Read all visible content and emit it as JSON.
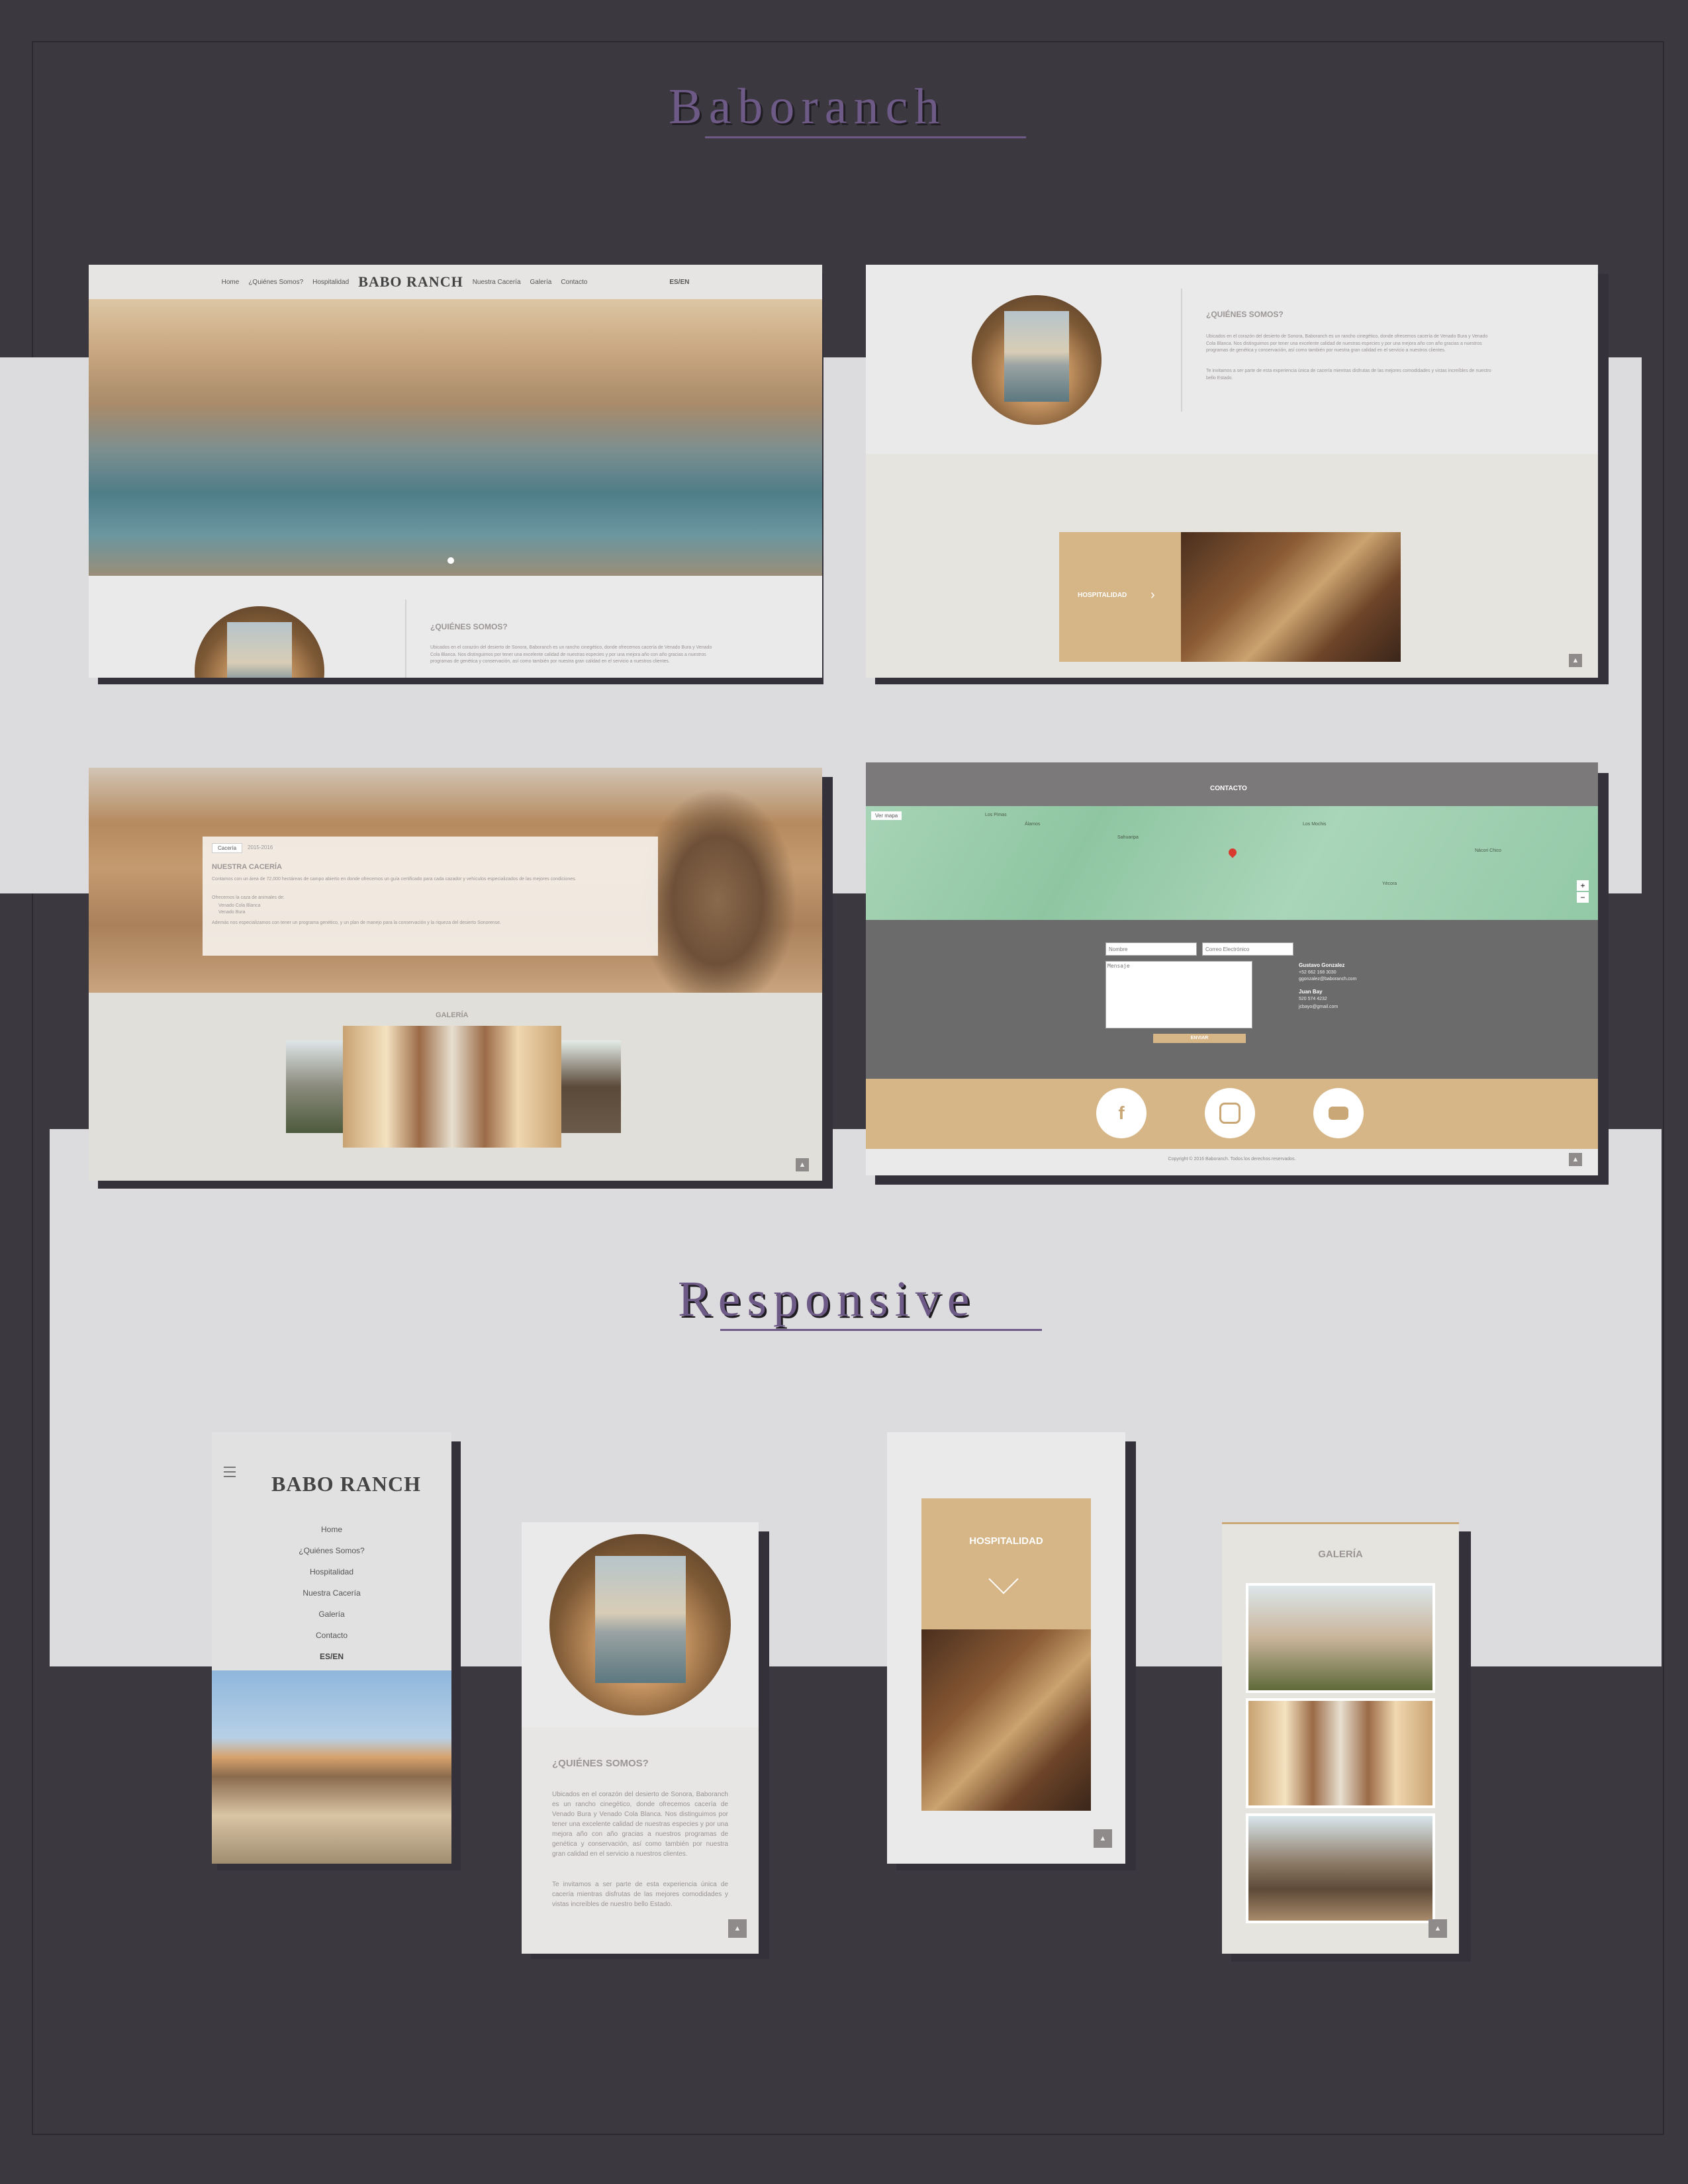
{
  "page": {
    "title": "Baboranch",
    "responsive_title": "Responsive"
  },
  "nav": {
    "items": [
      "Home",
      "¿Quiénes Somos?",
      "Hospitalidad",
      "Nuestra Cacería",
      "Galería",
      "Contacto"
    ],
    "lang": "ES/EN",
    "logo": "BABO RANCH"
  },
  "about": {
    "heading": "¿QUIÉNES SOMOS?",
    "p1": "Ubicados en el corazón del desierto de Sonora, Baboranch es un rancho cinegético, donde ofrecemos cacería de Venado Bura y Venado Cola Blanca. Nos distinguimos por tener una excelente calidad de nuestras especies y por una mejora año con año gracias a nuestros programas de genética y conservación, así como también por nuestra gran calidad en el servicio a nuestros clientes.",
    "p2": "Te invitamos a ser parte de esta experiencia única de cacería mientras disfrutas de las mejores comodidades y vistas increíbles de nuestro bello Estado."
  },
  "hospitality": {
    "label": "HOSPITALIDAD"
  },
  "hunting": {
    "tabs": [
      "Cacería",
      "2015-2016"
    ],
    "heading": "NUESTRA CACERÍA",
    "p1": "Contamos con un área de 72,000 hectáreas de campo abierto en donde ofrecemos un guía certificado para cada cazador y vehículos especializados de las mejores condiciones.",
    "p2": "Ofrecemos la caza de animales de:",
    "list": [
      "Venado Cola Blanca",
      "Venado Bura"
    ],
    "p3": "Además nos especializamos con tener un programa genético, y un plan de manejo para la conservación y la riqueza del desierto Sonorense."
  },
  "gallery": {
    "heading": "GALERÍA"
  },
  "contact": {
    "heading": "CONTACTO",
    "map_toggle": "Ver mapa",
    "fields": {
      "name": "Nombre",
      "email": "Correo Electrónico",
      "message": "Mensaje"
    },
    "submit": "ENVIAR",
    "person1": {
      "name": "Gustavo Gonzalez",
      "phone": "+52 662 168 3030",
      "email": "ggonzalez@baboranch.com"
    },
    "person2": {
      "name": "Juan Bay",
      "phone": "520 574 4232",
      "email": "jcbayo@gmail.com"
    },
    "map_places": [
      "Los Pimas",
      "Álamos",
      "Sahuaripa",
      "Los Mochis",
      "Yécora",
      "Nácori Chico"
    ]
  },
  "social": {
    "icons": [
      "facebook-icon",
      "instagram-icon",
      "youtube-icon"
    ]
  },
  "footer": {
    "copyright": "Copyright © 2016 Baboranch. Todos los derechos reservados."
  },
  "colors": {
    "background": "#3b3840",
    "band": "#dcdbdd",
    "accent_purple": "#6e5a86",
    "tan": "#d6b586"
  }
}
